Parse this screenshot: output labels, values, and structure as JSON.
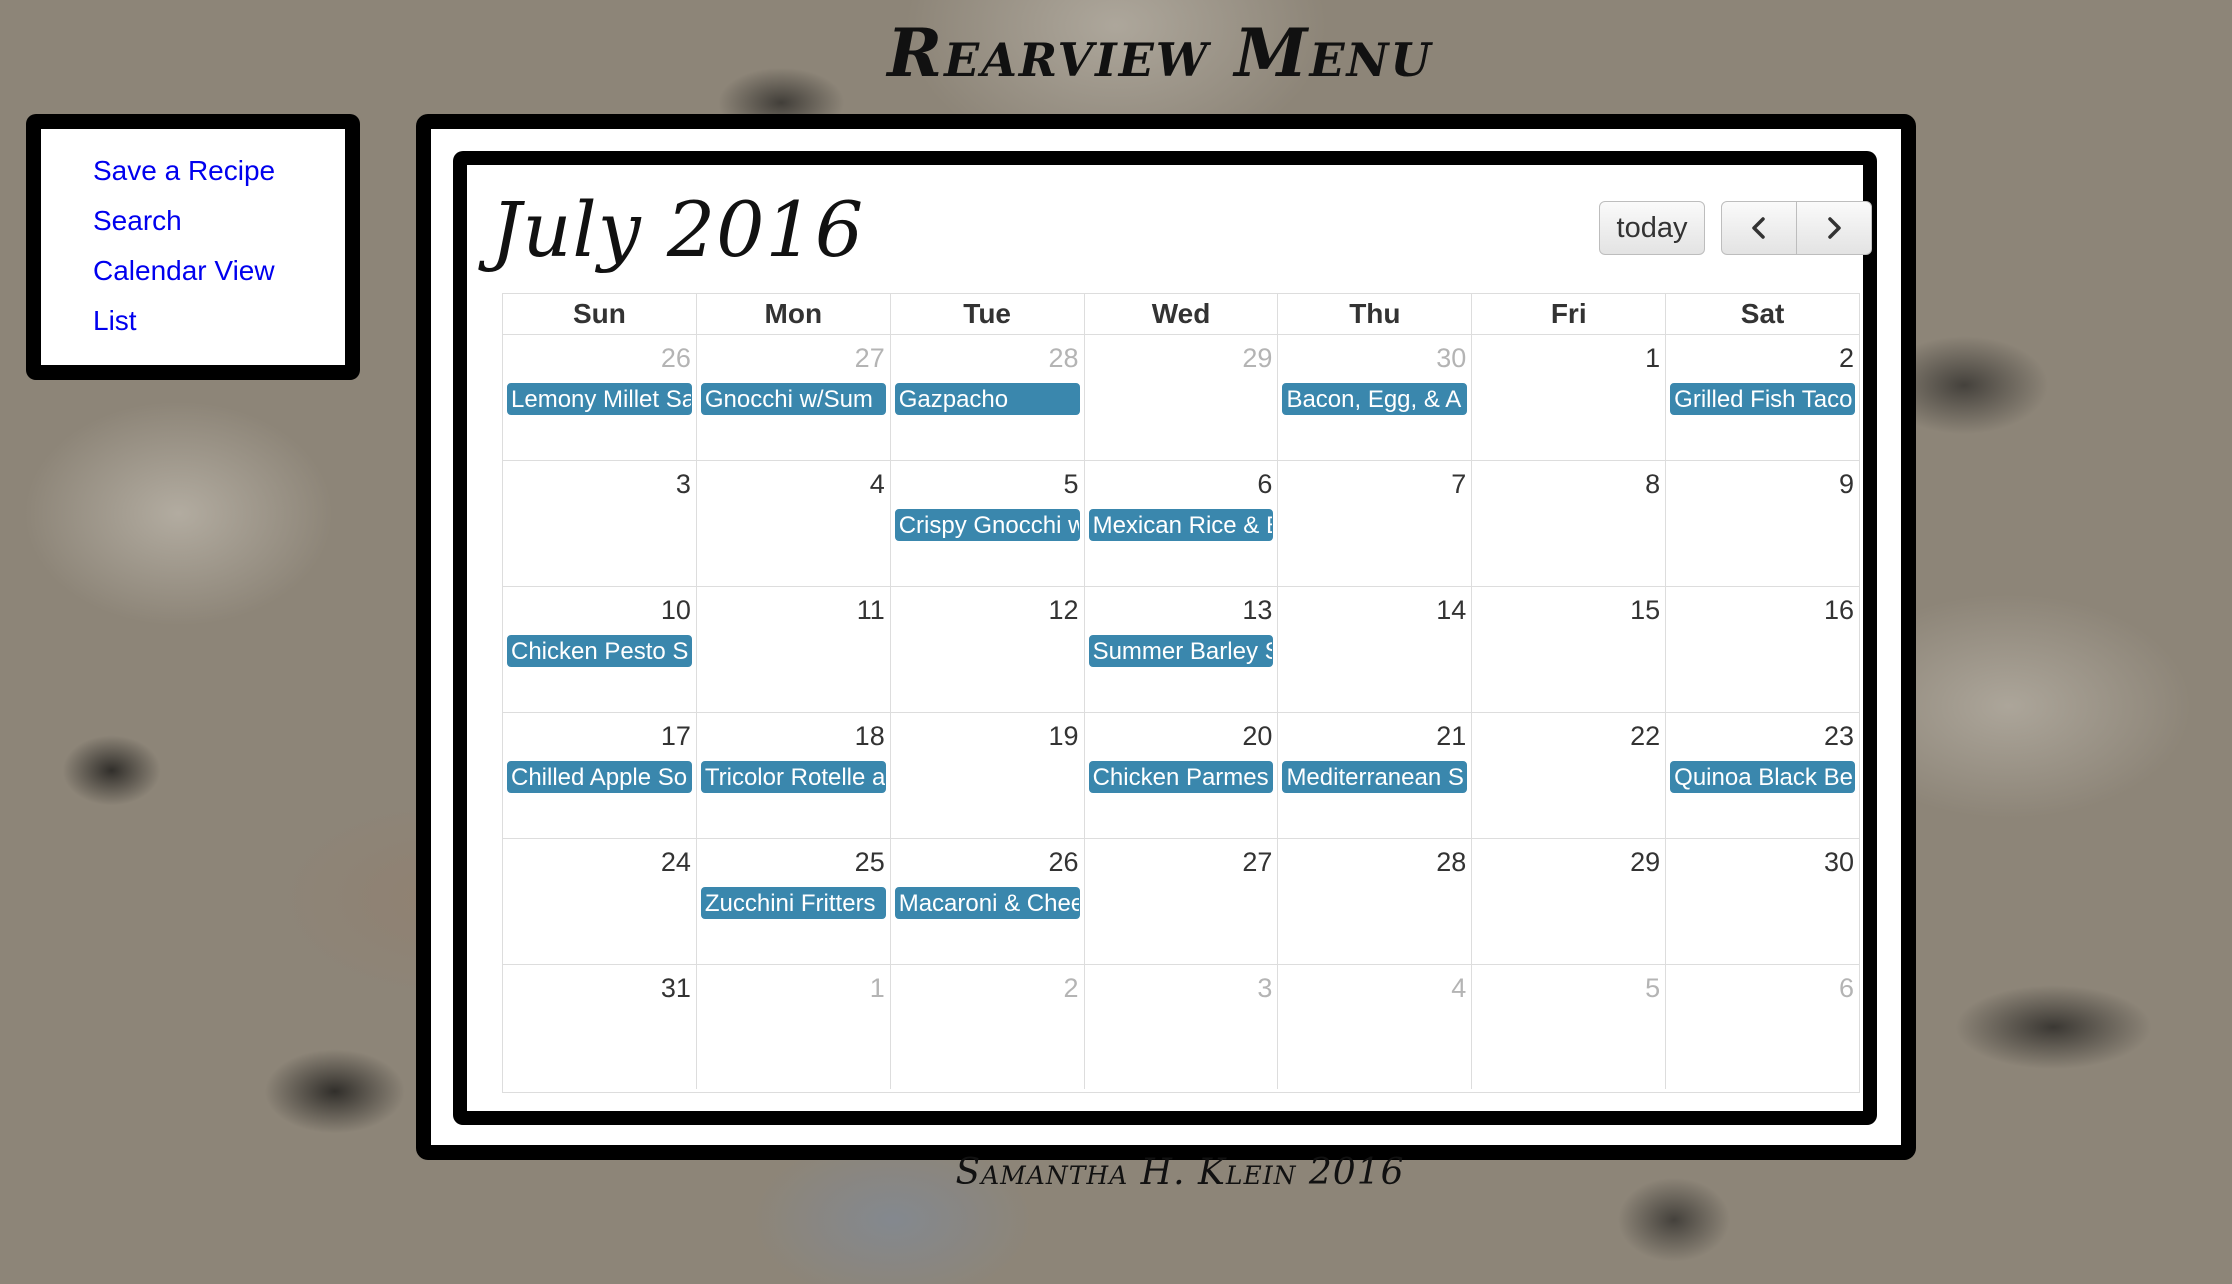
{
  "site_title": "Rearview Menu",
  "footer_credit": "Samantha H. Klein 2016",
  "sidebar": {
    "links": [
      {
        "label": "Save a Recipe",
        "name": "nav-save-recipe"
      },
      {
        "label": "Search",
        "name": "nav-search"
      },
      {
        "label": "Calendar View",
        "name": "nav-calendar-view"
      },
      {
        "label": "List",
        "name": "nav-list"
      }
    ]
  },
  "calendar": {
    "title": "July 2016",
    "today_label": "today",
    "prev_icon": "chevron-left-icon",
    "next_icon": "chevron-right-icon",
    "day_headers": [
      "Sun",
      "Mon",
      "Tue",
      "Wed",
      "Thu",
      "Fri",
      "Sat"
    ],
    "weeks": [
      [
        {
          "day": "26",
          "other": true,
          "event": "Lemony Millet Sa"
        },
        {
          "day": "27",
          "other": true,
          "event": "Gnocchi w/Sum"
        },
        {
          "day": "28",
          "other": true,
          "event": "Gazpacho"
        },
        {
          "day": "29",
          "other": true,
          "event": ""
        },
        {
          "day": "30",
          "other": true,
          "event": "Bacon, Egg, & A"
        },
        {
          "day": "1",
          "other": false,
          "event": ""
        },
        {
          "day": "2",
          "other": false,
          "event": "Grilled Fish Taco"
        }
      ],
      [
        {
          "day": "3",
          "other": false,
          "event": ""
        },
        {
          "day": "4",
          "other": false,
          "event": ""
        },
        {
          "day": "5",
          "other": false,
          "event": "Crispy Gnocchi w"
        },
        {
          "day": "6",
          "other": false,
          "event": "Mexican Rice & B"
        },
        {
          "day": "7",
          "other": false,
          "event": ""
        },
        {
          "day": "8",
          "other": false,
          "event": ""
        },
        {
          "day": "9",
          "other": false,
          "event": ""
        }
      ],
      [
        {
          "day": "10",
          "other": false,
          "event": "Chicken Pesto S"
        },
        {
          "day": "11",
          "other": false,
          "event": ""
        },
        {
          "day": "12",
          "other": false,
          "event": ""
        },
        {
          "day": "13",
          "other": false,
          "event": "Summer Barley S"
        },
        {
          "day": "14",
          "other": false,
          "event": ""
        },
        {
          "day": "15",
          "other": false,
          "event": ""
        },
        {
          "day": "16",
          "other": false,
          "event": ""
        }
      ],
      [
        {
          "day": "17",
          "other": false,
          "event": "Chilled Apple So"
        },
        {
          "day": "18",
          "other": false,
          "event": "Tricolor Rotelle a"
        },
        {
          "day": "19",
          "other": false,
          "event": ""
        },
        {
          "day": "20",
          "other": false,
          "event": "Chicken Parmes"
        },
        {
          "day": "21",
          "other": false,
          "event": "Mediterranean S"
        },
        {
          "day": "22",
          "other": false,
          "event": ""
        },
        {
          "day": "23",
          "other": false,
          "event": "Quinoa Black Be"
        }
      ],
      [
        {
          "day": "24",
          "other": false,
          "event": ""
        },
        {
          "day": "25",
          "other": false,
          "event": "Zucchini Fritters"
        },
        {
          "day": "26",
          "other": false,
          "event": "Macaroni & Chee"
        },
        {
          "day": "27",
          "other": false,
          "event": ""
        },
        {
          "day": "28",
          "other": false,
          "event": ""
        },
        {
          "day": "29",
          "other": false,
          "event": ""
        },
        {
          "day": "30",
          "other": false,
          "event": ""
        }
      ],
      [
        {
          "day": "31",
          "other": false,
          "event": ""
        },
        {
          "day": "1",
          "other": true,
          "event": ""
        },
        {
          "day": "2",
          "other": true,
          "event": ""
        },
        {
          "day": "3",
          "other": true,
          "event": ""
        },
        {
          "day": "4",
          "other": true,
          "event": ""
        },
        {
          "day": "5",
          "other": true,
          "event": ""
        },
        {
          "day": "6",
          "other": true,
          "event": ""
        }
      ]
    ]
  },
  "colors": {
    "event_bg": "#3a87ad",
    "link": "#0000ee",
    "frame": "#000000"
  }
}
